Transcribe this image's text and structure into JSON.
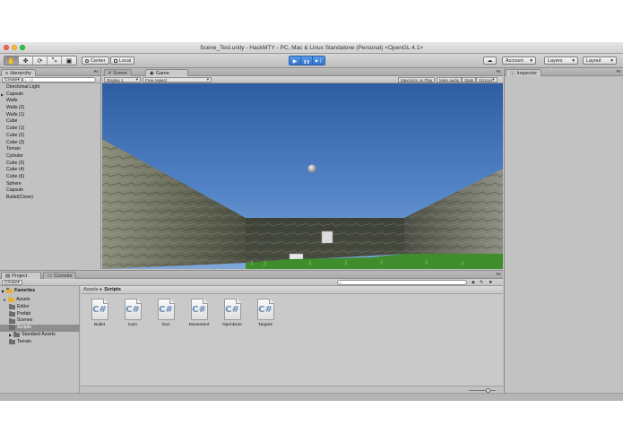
{
  "window": {
    "title": "Scene_Test.unity - HackMTY - PC, Mac & Linux Standalone (Personal) <OpenGL 4.1>"
  },
  "toolbar": {
    "tools": [
      {
        "name": "hand-tool",
        "glyph": "✋"
      },
      {
        "name": "move-tool",
        "glyph": "✥"
      },
      {
        "name": "rotate-tool",
        "glyph": "⟳"
      },
      {
        "name": "scale-tool",
        "glyph": "⤡"
      },
      {
        "name": "rect-tool",
        "glyph": "▣"
      }
    ],
    "pivot_label": "Center",
    "space_label": "Local",
    "play_glyph": "▶",
    "pause_glyph": "❚❚",
    "step_glyph": "▶❘",
    "cloud_glyph": "☁",
    "account_label": "Account",
    "layers_label": "Layers",
    "layout_label": "Layout",
    "dropdown_glyph": "▾"
  },
  "hierarchy": {
    "tab_label": "Hierarchy",
    "create_label": "Create",
    "search_placeholder": "All",
    "items": [
      "Directional Light",
      "Capsule",
      "Walls",
      "Walls (2)",
      "Walls (1)",
      "Cube",
      "Cube (1)",
      "Cube (2)",
      "Cube (3)",
      "Terrain",
      "Cylinder",
      "Cube (5)",
      "Cube (4)",
      "Cube (6)",
      "Sphere",
      "Capsule",
      "Bullet(Clone)"
    ]
  },
  "scene_tabs": {
    "scene_label": "Scene",
    "game_label": "Game"
  },
  "game": {
    "display_label": "Display 1",
    "aspect_label": "Free Aspect",
    "maximize_label": "Maximize on Play",
    "mute_label": "Mute audio",
    "stats_label": "Stats",
    "gizmos_label": "Gizmos"
  },
  "project": {
    "project_tab": "Project",
    "console_tab": "Console",
    "create_label": "Create",
    "favorites_label": "Favorites",
    "tree": [
      {
        "label": "Assets",
        "depth": 0,
        "selected": false
      },
      {
        "label": "Editor",
        "depth": 1,
        "selected": false
      },
      {
        "label": "Prefab",
        "depth": 1,
        "selected": false
      },
      {
        "label": "Scenes",
        "depth": 1,
        "selected": false
      },
      {
        "label": "Scripts",
        "depth": 1,
        "selected": true
      },
      {
        "label": "Standard Assets",
        "depth": 1,
        "selected": false
      },
      {
        "label": "Terrain",
        "depth": 1,
        "selected": false
      }
    ],
    "breadcrumb": {
      "root": "Assets",
      "separator": "▸",
      "current": "Scripts"
    },
    "assets": [
      "Bullet",
      "Cam",
      "Gun",
      "Movement",
      "OpenDoor",
      "Targets"
    ],
    "cs_glyph": "C#"
  },
  "inspector": {
    "tab_label": "Inspector"
  }
}
